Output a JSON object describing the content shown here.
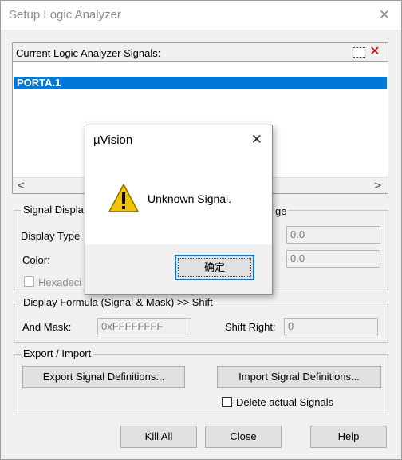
{
  "window": {
    "title": "Setup Logic Analyzer",
    "close": "✕"
  },
  "signals": {
    "caption": "Current Logic Analyzer Signals:",
    "new_icon": "new-signal-icon",
    "delete_icon": "delete-signal-icon",
    "delete_glyph": "✕",
    "items": [
      "PORTA.1"
    ],
    "scroll_left": "<",
    "scroll_right": ">"
  },
  "signal_display": {
    "legend": "Signal Displa",
    "display_type_label": "Display Type",
    "color_label": "Color:",
    "hexadecimal_label": "Hexadeci",
    "range_legend": "ge",
    "max_value": "0.0",
    "min_value": "0.0"
  },
  "formula": {
    "legend": "Display Formula (Signal & Mask) >> Shift",
    "and_mask_label": "And Mask:",
    "and_mask_value": "0xFFFFFFFF",
    "shift_right_label": "Shift Right:",
    "shift_right_value": "0"
  },
  "export_import": {
    "legend": "Export / Import",
    "export_button": "Export Signal Definitions...",
    "import_button": "Import Signal Definitions...",
    "delete_actual_label": "Delete actual Signals"
  },
  "footer": {
    "kill_all": "Kill All",
    "close": "Close",
    "help": "Help"
  },
  "popup": {
    "title": "µVision",
    "close": "✕",
    "icon": "warning-icon",
    "message": "Unknown Signal.",
    "ok_button": "确定"
  },
  "colors": {
    "selection": "#0078d7",
    "dialog_bg": "#f0f0f0",
    "warning": "#f5c400"
  }
}
